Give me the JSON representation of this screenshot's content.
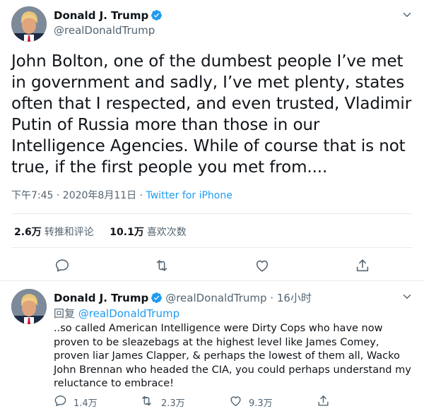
{
  "tweet": {
    "author_name": "Donald J. Trump",
    "author_handle": "@realDonaldTrump",
    "text": "John Bolton, one of the dumbest people I’ve met in government and sadly, I’ve met plenty, states often that I respected, and even trusted, Vladimir Putin of Russia more than those in our Intelligence Agencies. While of course that is not true, if the first people you met from....",
    "timestamp": "下午7:45 · 2020年8月11日",
    "separator": " · ",
    "source": "Twitter for iPhone",
    "retweets_count": "2.6万",
    "retweets_label": "转推和评论",
    "likes_count": "10.1万",
    "likes_label": "喜欢次数"
  },
  "reply": {
    "author_name": "Donald J. Trump",
    "author_handle": "@realDonaldTrump",
    "time": "· 16小时",
    "replying_prefix": "回复 ",
    "replying_to": "@realDonaldTrump",
    "text": "..so called American Intelligence were Dirty Cops who have now proven to be sleazebags at the highest level like James Comey, proven liar James Clapper, & perhaps the lowest of them all, Wacko John Brennan who headed the CIA, you could perhaps understand my reluctance to embrace!",
    "reply_count": "1.4万",
    "retweet_count": "2.3万",
    "like_count": "9.3万"
  },
  "icons": {
    "verified": "verified-badge-icon",
    "caret": "chevron-down-icon",
    "reply": "reply-icon",
    "retweet": "retweet-icon",
    "like": "heart-icon",
    "share": "share-icon"
  },
  "colors": {
    "accent": "#1d9bf0",
    "text": "#0f1419",
    "secondary": "#536471",
    "divider": "#e6ecf0"
  }
}
